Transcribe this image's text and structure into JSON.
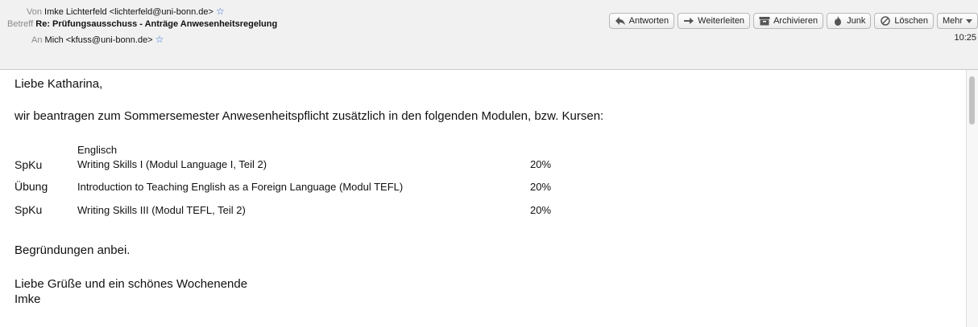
{
  "header": {
    "from_label": "Von",
    "from_value": "Imke Lichterfeld <lichterfeld@uni-bonn.de>",
    "subject_label": "Betreff",
    "subject_value": "Re: Prüfungsausschuss - Anträge Anwesenheitsregelung",
    "to_label": "An",
    "to_value": "Mich <kfuss@uni-bonn.de>",
    "time": "10:25"
  },
  "toolbar": {
    "reply": "Antworten",
    "forward": "Weiterleiten",
    "archive": "Archivieren",
    "junk": "Junk",
    "delete": "Löschen",
    "more": "Mehr"
  },
  "message": {
    "greeting": "Liebe Katharina,",
    "intro": "wir beantragen zum Sommersemester Anwesenheitspflicht zusätzlich in den folgenden Modulen, bzw. Kursen:",
    "table": {
      "heading": "Englisch",
      "rows": [
        {
          "type": "SpKu",
          "course": "Writing Skills I (Modul Language I, Teil 2)",
          "percent": "20%"
        },
        {
          "type": "Übung",
          "course": "Introduction to Teaching English as a Foreign Language (Modul TEFL)",
          "percent": "20%"
        },
        {
          "type": "SpKu",
          "course": "Writing Skills III (Modul TEFL, Teil 2)",
          "percent": "20%"
        }
      ]
    },
    "reasons": "Begründungen anbei.",
    "closing": "Liebe Grüße und ein schönes Wochenende",
    "signature": "Imke"
  }
}
